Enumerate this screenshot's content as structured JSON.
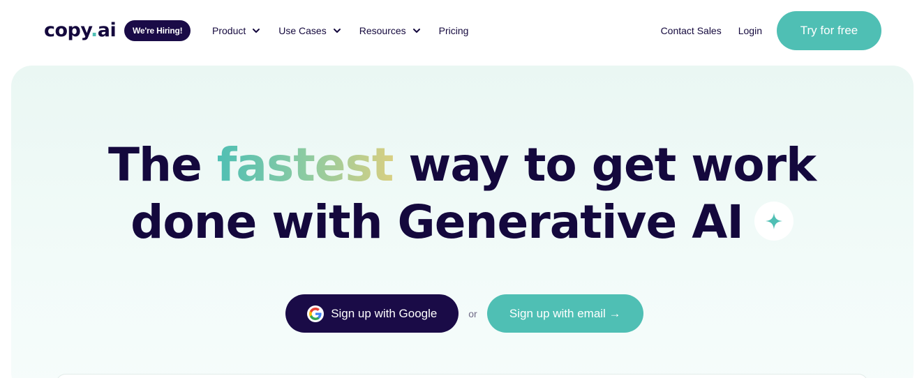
{
  "nav": {
    "logo": {
      "main": "copy",
      "dot": ".",
      "suffix": "ai"
    },
    "hiring_badge": "We're Hiring!",
    "menu": [
      {
        "label": "Product",
        "icon": "chevron-down-icon"
      },
      {
        "label": "Use Cases",
        "icon": "chevron-down-icon"
      },
      {
        "label": "Resources",
        "icon": "chevron-down-icon"
      },
      {
        "label": "Pricing"
      }
    ],
    "contact_sales": "Contact Sales",
    "login": "Login",
    "try_free": "Try for free"
  },
  "hero": {
    "headline_part1": "The ",
    "headline_accent": "fastest",
    "headline_part2": " way to get work",
    "headline_line2": "done with Generative AI",
    "sparkle_icon": "sparkle-icon",
    "google_button": "Sign up with Google",
    "google_icon": "google-icon",
    "or": "or",
    "email_button": "Sign up with email →"
  },
  "colors": {
    "brand_dark": "#1a0b47",
    "accent_teal": "#4fbfb4",
    "hero_bg": "#eaf7f3"
  }
}
